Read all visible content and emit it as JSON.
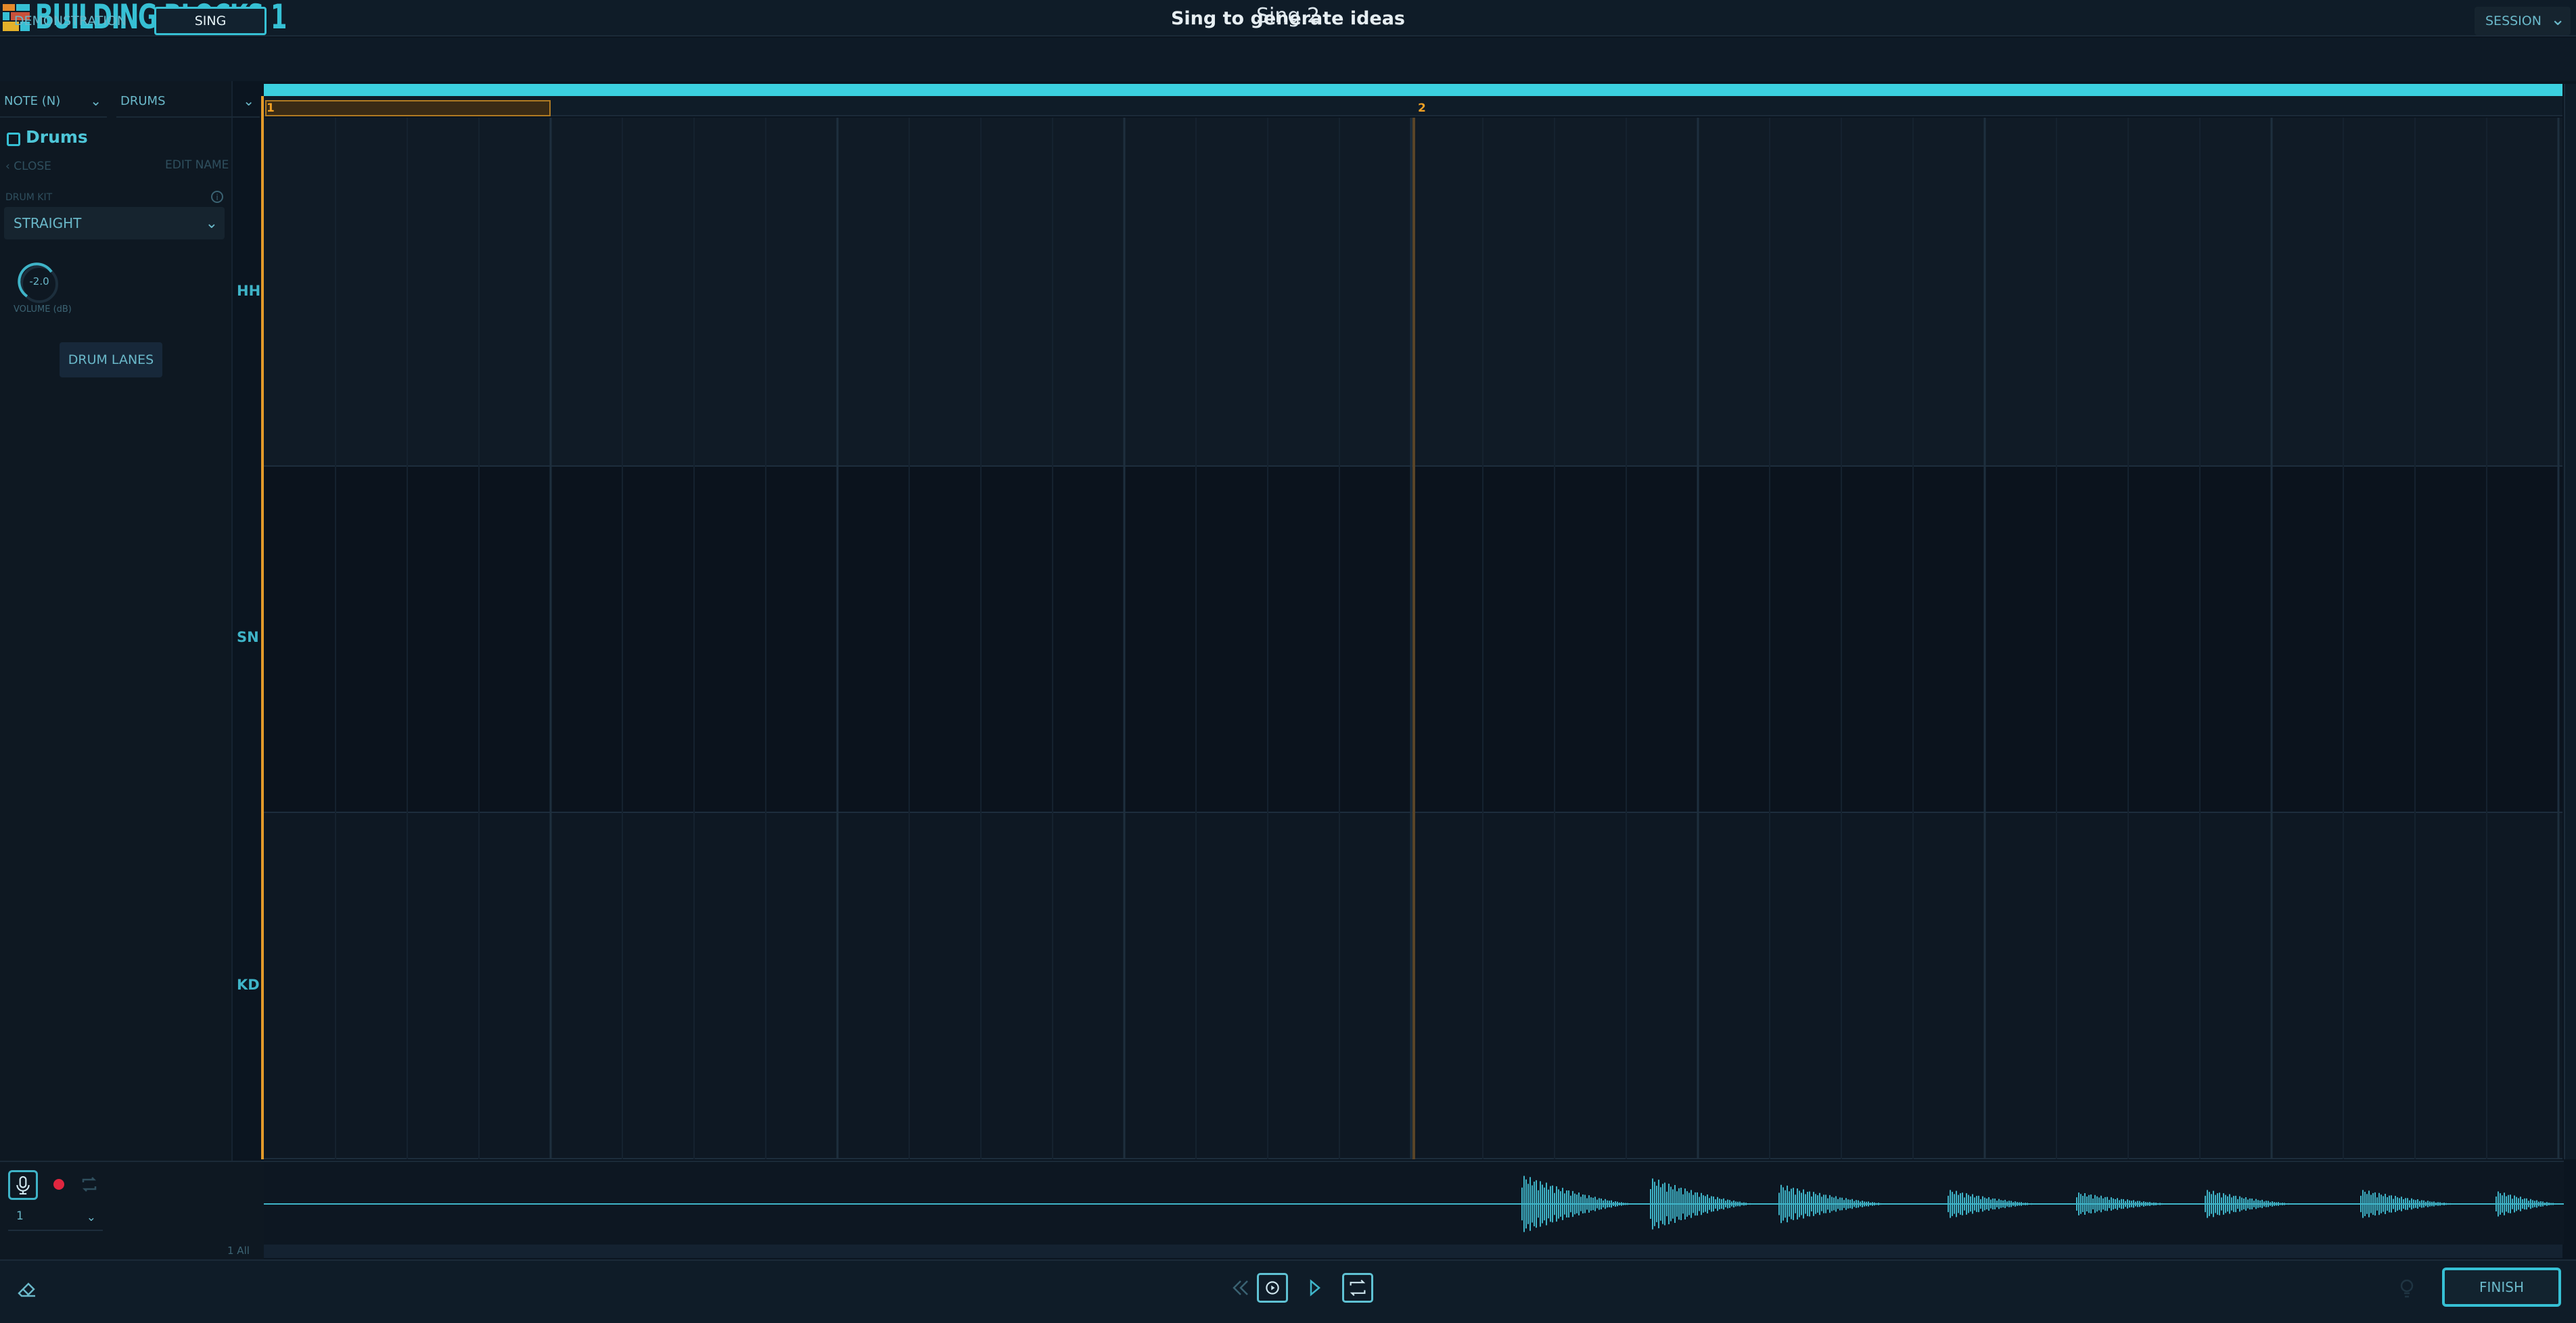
{
  "app": {
    "title": "BUILDING BLOCKS 1",
    "window_title": "Sing 2"
  },
  "tabs": [
    "DEMONSTRATION",
    "SING"
  ],
  "subtitle": "Sing to generate ideas",
  "session": {
    "label": "SESSION"
  },
  "toolbar": {
    "note_dropdown": "NOTE (N)",
    "instrument_dropdown": "DRUMS"
  },
  "track": {
    "name": "Drums",
    "close_label": "CLOSE",
    "edit_name_label": "EDIT NAME",
    "drum_kit_label": "DRUM KIT",
    "drum_kit_value": "STRAIGHT",
    "volume_value": "-2.0",
    "volume_label": "VOLUME (dB)",
    "drum_lanes_label": "DRUM LANES"
  },
  "timeline": {
    "bar_numbers": [
      "1",
      "2"
    ]
  },
  "lanes": [
    "HH",
    "SN",
    "KD"
  ],
  "recorder": {
    "take_value": "1",
    "count_label": "1 All"
  },
  "transport": {
    "finish_label": "FINISH"
  },
  "colors": {
    "accent": "#36c0d4",
    "playhead": "#e39a2a",
    "background": "#0b1520"
  },
  "icons": [
    "logo-icon",
    "menu-icon",
    "info-icon",
    "mic-icon",
    "record-icon",
    "loop-icon",
    "eraser-icon",
    "rewind-icon",
    "restart-icon",
    "play-icon",
    "hint-icon"
  ]
}
